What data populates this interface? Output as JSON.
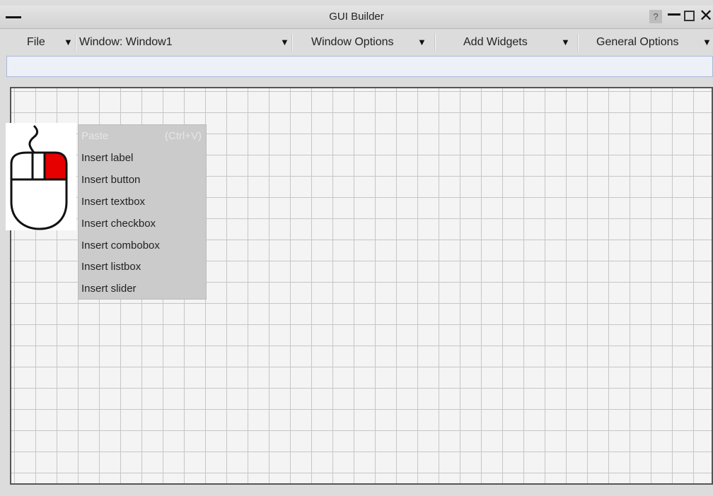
{
  "window": {
    "title": "GUI Builder",
    "help_label": "?"
  },
  "menubar": {
    "file": "File",
    "window_select": "Window: Window1",
    "window_options": "Window Options",
    "add_widgets": "Add Widgets",
    "general_options": "General Options",
    "arrow": "▼"
  },
  "context_menu": {
    "items": [
      {
        "label": "Paste",
        "shortcut": "(Ctrl+V)",
        "enabled": false
      },
      {
        "label": "Insert label"
      },
      {
        "label": "Insert button"
      },
      {
        "label": "Insert textbox"
      },
      {
        "label": "Insert checkbox"
      },
      {
        "label": "Insert combobox"
      },
      {
        "label": "Insert listbox"
      },
      {
        "label": "Insert slider"
      }
    ]
  },
  "mouse_hint": {
    "icon": "right-mouse-button-icon",
    "highlight_color": "#e60000"
  }
}
